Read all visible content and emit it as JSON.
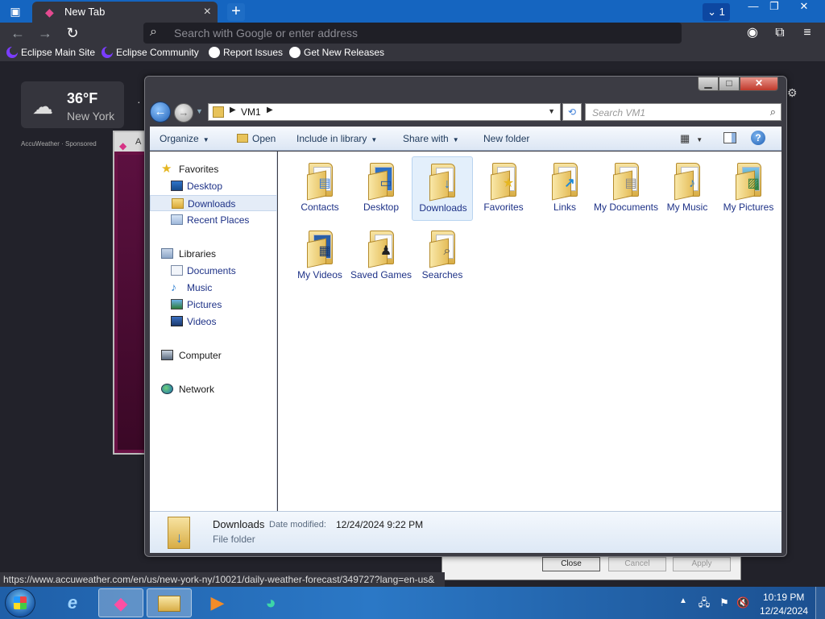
{
  "browser": {
    "tab_title": "New Tab",
    "tab_count": "1",
    "address_placeholder": "Search with Google or enter address",
    "bookmarks": [
      "Eclipse Main Site",
      "Eclipse Community",
      "Report Issues",
      "Get New Releases"
    ],
    "status_url": "https://www.accuweather.com/en/us/new-york-ny/10021/daily-weather-forecast/349727?lang=en-us&"
  },
  "weather": {
    "temp": "36°F",
    "city": "New York",
    "sponsor": "AccuWeather · Sponsored",
    "icon": "cloud-sun-icon"
  },
  "background_window": {
    "title": "A"
  },
  "background_dialog": {
    "close_label": "Close",
    "cancel_label": "Cancel",
    "apply_label": "Apply"
  },
  "explorer": {
    "address_segment": "VM1",
    "search_placeholder": "Search VM1",
    "toolbar": {
      "organize": "Organize",
      "open": "Open",
      "include": "Include in library",
      "share": "Share with",
      "new_folder": "New folder"
    },
    "nav": {
      "favorites": "Favorites",
      "desktop": "Desktop",
      "downloads": "Downloads",
      "recent": "Recent Places",
      "libraries": "Libraries",
      "documents": "Documents",
      "music": "Music",
      "pictures": "Pictures",
      "videos": "Videos",
      "computer": "Computer",
      "network": "Network",
      "selected": "Downloads"
    },
    "items": [
      {
        "label": "Contacts",
        "icon": "contacts-icon"
      },
      {
        "label": "Desktop",
        "icon": "desktop-icon"
      },
      {
        "label": "Downloads",
        "icon": "download-arrow-icon"
      },
      {
        "label": "Favorites",
        "icon": "star-icon"
      },
      {
        "label": "Links",
        "icon": "link-arrow-icon"
      },
      {
        "label": "My Documents",
        "icon": "document-icon"
      },
      {
        "label": "My Music",
        "icon": "music-note-icon"
      },
      {
        "label": "My Pictures",
        "icon": "picture-icon"
      },
      {
        "label": "My Videos",
        "icon": "film-icon"
      },
      {
        "label": "Saved Games",
        "icon": "chess-piece-icon"
      },
      {
        "label": "Searches",
        "icon": "magnifier-icon"
      }
    ],
    "selected_item": "Downloads",
    "details": {
      "name": "Downloads",
      "modified_label": "Date modified:",
      "modified_value": "12/24/2024 9:22 PM",
      "type": "File folder"
    }
  },
  "taskbar": {
    "time": "10:19 PM",
    "date": "12/24/2024"
  }
}
